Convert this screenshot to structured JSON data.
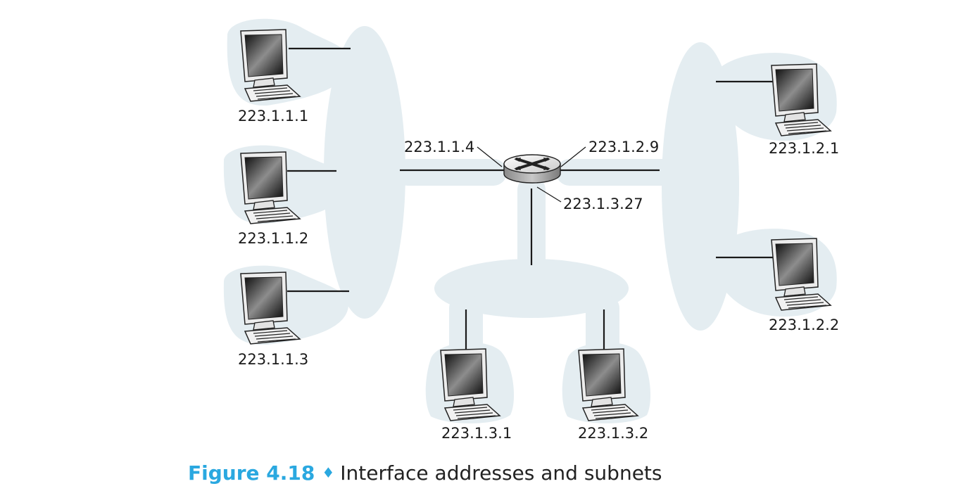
{
  "hosts": [
    {
      "id": "h111",
      "address": "223.1.1.1"
    },
    {
      "id": "h112",
      "address": "223.1.1.2"
    },
    {
      "id": "h113",
      "address": "223.1.1.3"
    },
    {
      "id": "h121",
      "address": "223.1.2.1"
    },
    {
      "id": "h122",
      "address": "223.1.2.2"
    },
    {
      "id": "h131",
      "address": "223.1.3.1"
    },
    {
      "id": "h132",
      "address": "223.1.3.2"
    }
  ],
  "router": {
    "interfaces": [
      {
        "id": "if1",
        "address": "223.1.1.4"
      },
      {
        "id": "if2",
        "address": "223.1.2.9"
      },
      {
        "id": "if3",
        "address": "223.1.3.27"
      }
    ]
  },
  "caption": {
    "figure": "Figure 4.18",
    "separator": "♦",
    "text": "Interface addresses and subnets"
  },
  "colors": {
    "subnet_fill": "#e4edf1",
    "caption_accent": "#2aa8e0",
    "line": "#1a1a1a"
  }
}
